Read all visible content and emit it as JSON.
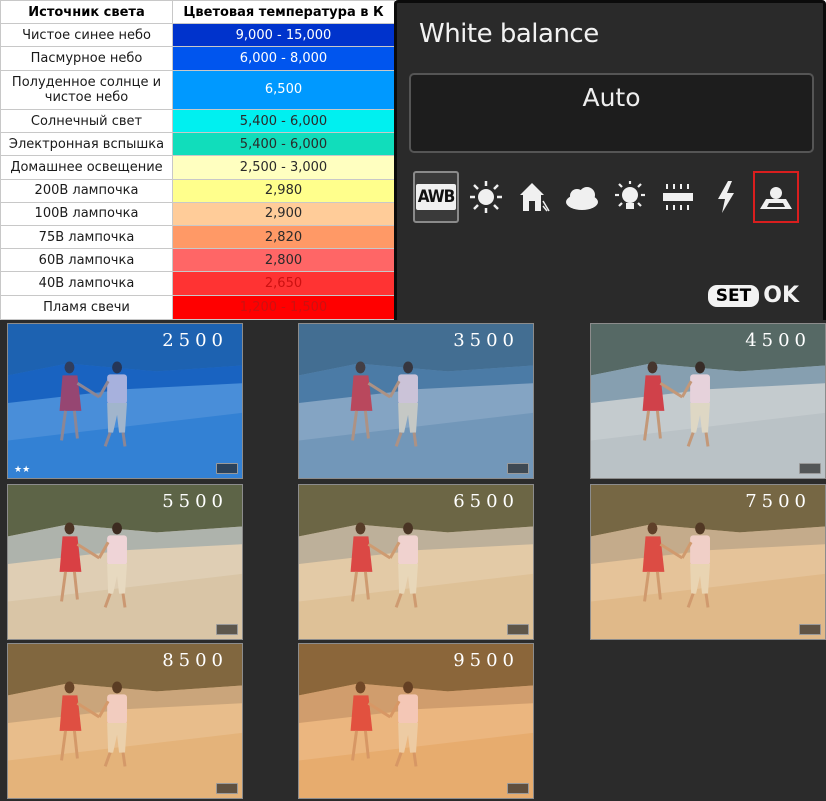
{
  "table": {
    "header": {
      "source": "Источник света",
      "temperature": "Цветовая температура в К"
    },
    "rows": [
      {
        "source": "Чистое синее небо",
        "value": "9,000 - 15,000",
        "color": "#0033cc",
        "dark": false
      },
      {
        "source": "Пасмурное небо",
        "value": "6,000 - 8,000",
        "color": "#0055ee",
        "dark": false
      },
      {
        "source": "Полуденное солнце и чистое небо",
        "value": "6,500",
        "color": "#0099ff",
        "dark": false
      },
      {
        "source": "Солнечный свет",
        "value": "5,400 - 6,000",
        "color": "#00f0f0",
        "dark": true
      },
      {
        "source": "Электронная вспышка",
        "value": "5,400 - 6,000",
        "color": "#11ddbb",
        "dark": true
      },
      {
        "source": "Домашнее освещение",
        "value": "2,500 - 3,000",
        "color": "#ffffc0",
        "dark": true
      },
      {
        "source": "200В лампочка",
        "value": "2,980",
        "color": "#ffff8c",
        "dark": true
      },
      {
        "source": "100В лампочка",
        "value": "2,900",
        "color": "#ffcc99",
        "dark": true
      },
      {
        "source": "75В лампочка",
        "value": "2,820",
        "color": "#ff9966",
        "dark": true
      },
      {
        "source": "60В лампочка",
        "value": "2,800",
        "color": "#ff6666",
        "dark": true
      },
      {
        "source": "40В лампочка",
        "value": "2,650",
        "color": "#ff3333",
        "dark": true
      },
      {
        "source": "Пламя свечи",
        "value": "1,200 - 1,500",
        "color": "#ff0000",
        "dark": true
      }
    ]
  },
  "camera": {
    "title": "White balance",
    "mode": "Auto",
    "icons": [
      {
        "name": "awb-icon",
        "label": "AWB"
      },
      {
        "name": "daylight-sun-icon"
      },
      {
        "name": "shade-house-icon"
      },
      {
        "name": "cloudy-icon"
      },
      {
        "name": "tungsten-bulb-icon"
      },
      {
        "name": "fluorescent-icon"
      },
      {
        "name": "flash-bolt-icon"
      },
      {
        "name": "custom-wb-icon"
      }
    ],
    "set_label": "SET",
    "ok_label": "OK",
    "accent_color": "#d91e1e"
  },
  "photos": [
    {
      "temperature": "2500",
      "stars": "★★"
    },
    {
      "temperature": "3500",
      "stars": ""
    },
    {
      "temperature": "4500",
      "stars": ""
    },
    {
      "temperature": "5500",
      "stars": ""
    },
    {
      "temperature": "6500",
      "stars": ""
    },
    {
      "temperature": "7500",
      "stars": ""
    },
    {
      "temperature": "8500",
      "stars": ""
    },
    {
      "temperature": "9500",
      "stars": ""
    }
  ]
}
